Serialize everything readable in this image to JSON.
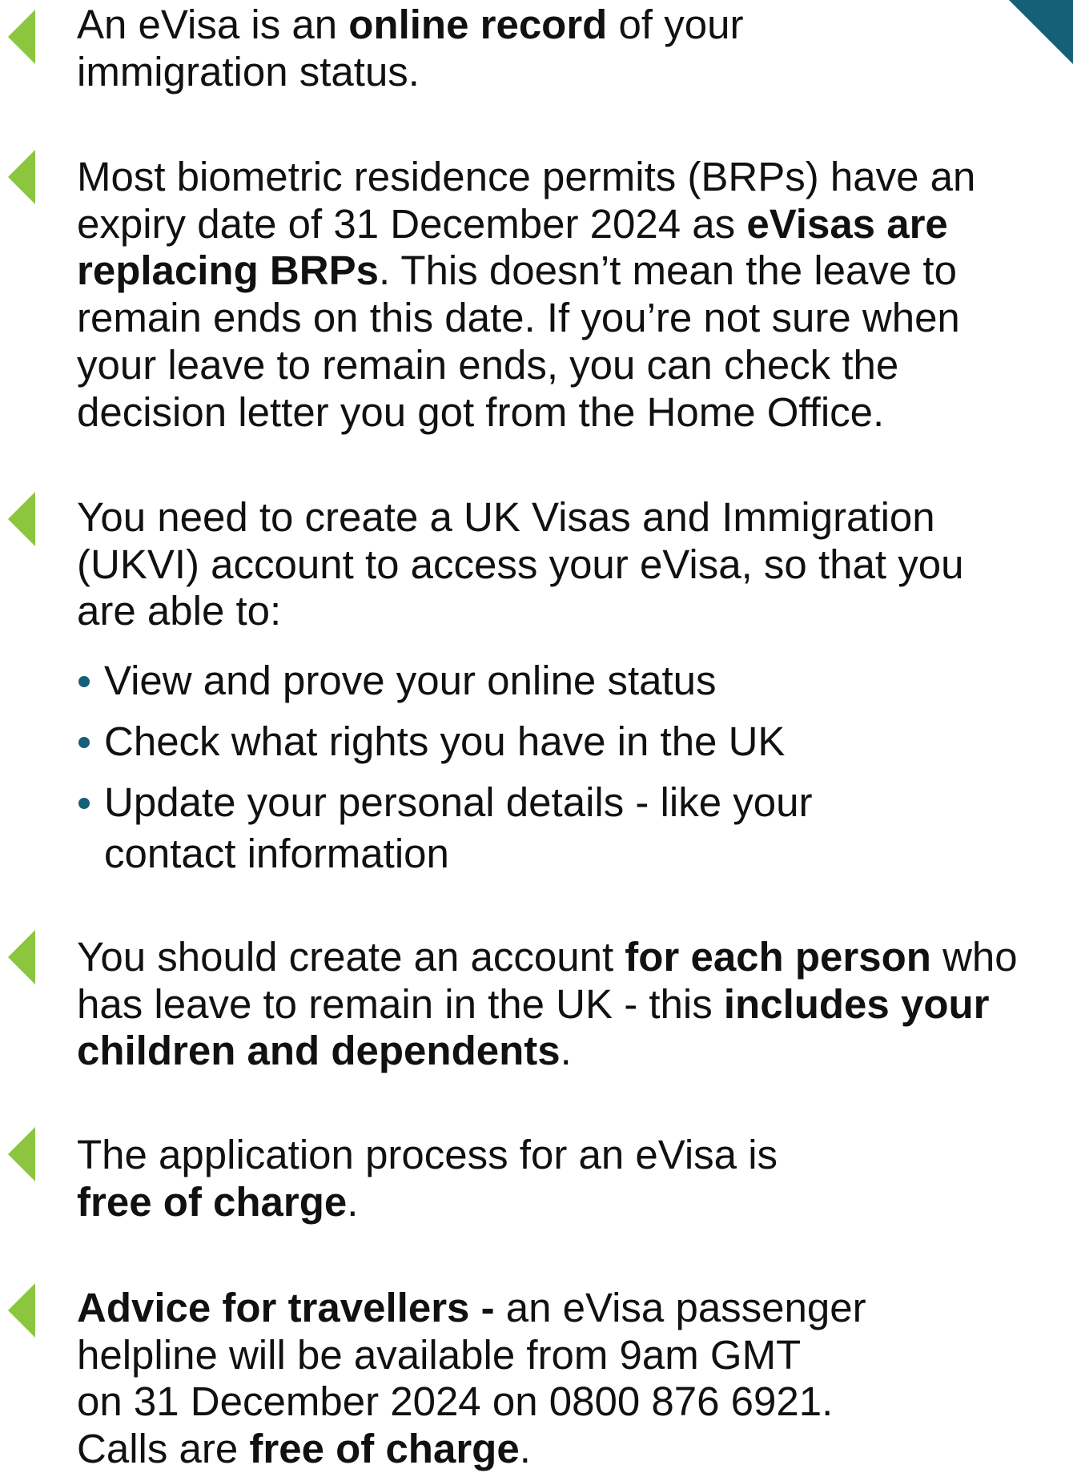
{
  "sections": [
    {
      "lines": [
        [
          {
            "t": "An eVisa is an ",
            "b": false
          },
          {
            "t": "online record",
            "b": true
          },
          {
            "t": " of your",
            "b": false
          }
        ],
        [
          {
            "t": "immigration status.",
            "b": false
          }
        ]
      ]
    },
    {
      "lines": [
        [
          {
            "t": "Most biometric residence permits (BRPs) have an",
            "b": false
          }
        ],
        [
          {
            "t": "expiry date of 31 December 2024 as ",
            "b": false
          },
          {
            "t": "eVisas are",
            "b": true
          }
        ],
        [
          {
            "t": "replacing BRPs",
            "b": true
          },
          {
            "t": ". This doesn’t mean the leave to",
            "b": false
          }
        ],
        [
          {
            "t": "remain ends on this date. If you’re not sure when",
            "b": false
          }
        ],
        [
          {
            "t": "your leave to remain ends, you can check the",
            "b": false
          }
        ],
        [
          {
            "t": "decision letter you got from the Home Office.",
            "b": false
          }
        ]
      ]
    },
    {
      "lines": [
        [
          {
            "t": "You need to create a UK Visas and Immigration",
            "b": false
          }
        ],
        [
          {
            "t": "(UKVI) account to access your eVisa, so that you",
            "b": false
          }
        ],
        [
          {
            "t": "are able to:",
            "b": false
          }
        ]
      ],
      "bullets": [
        "View and prove your online status",
        "Check what rights you have in the UK",
        "Update your personal details - like your contact information"
      ]
    },
    {
      "lines": [
        [
          {
            "t": "You should create an account ",
            "b": false
          },
          {
            "t": "for each person",
            "b": true
          },
          {
            "t": " who",
            "b": false
          }
        ],
        [
          {
            "t": "has leave to remain in the UK - this ",
            "b": false
          },
          {
            "t": "includes your",
            "b": true
          }
        ],
        [
          {
            "t": "children and dependents",
            "b": true
          },
          {
            "t": ".",
            "b": false
          }
        ]
      ]
    },
    {
      "lines": [
        [
          {
            "t": "The application process for an eVisa is",
            "b": false
          }
        ],
        [
          {
            "t": "free of charge",
            "b": true
          },
          {
            "t": ".",
            "b": false
          }
        ]
      ]
    },
    {
      "lines": [
        [
          {
            "t": "Advice for travellers - ",
            "b": true
          },
          {
            "t": "an eVisa passenger",
            "b": false
          }
        ],
        [
          {
            "t": "helpline will be available from 9am GMT",
            "b": false
          }
        ],
        [
          {
            "t": "on 31 December 2024 on 0800 876 6921.",
            "b": false
          }
        ],
        [
          {
            "t": "Calls are ",
            "b": false
          },
          {
            "t": "free of charge",
            "b": true
          },
          {
            "t": ".",
            "b": false
          }
        ]
      ]
    }
  ],
  "colors": {
    "marker": "#8cc63f",
    "accent": "#155f78",
    "text": "#111111"
  }
}
